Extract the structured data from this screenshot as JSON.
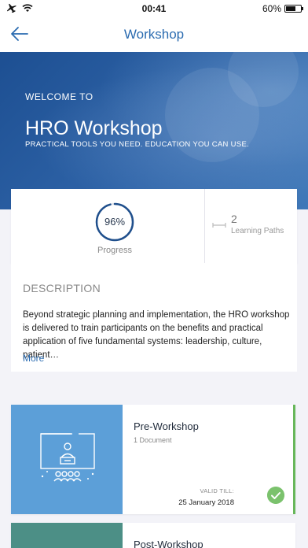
{
  "status_bar": {
    "time": "00:41",
    "battery": "60%"
  },
  "nav": {
    "title": "Workshop"
  },
  "hero": {
    "welcome": "WELCOME TO",
    "title": "HRO Workshop",
    "subtitle": "PRACTICAL TOOLS YOU NEED. EDUCATION YOU CAN USE."
  },
  "stats": {
    "progress_percent": 96,
    "progress_text": "96%",
    "progress_label": "Progress",
    "learning_paths_count": "2",
    "learning_paths_label": "Learning Paths"
  },
  "description": {
    "title": "DESCRIPTION",
    "text": "Beyond strategic planning and implementation, the HRO workshop is delivered to train participants on the benefits and practical application of five fundamental systems: leadership, culture, patient…",
    "more_label": "More"
  },
  "cards": [
    {
      "title": "Pre-Workshop",
      "meta": "1 Document",
      "valid_label": "VALID TILL:",
      "valid_date": "25 January 2018",
      "completed": true,
      "icon": "presentation-icon"
    },
    {
      "title": "Post-Workshop"
    }
  ],
  "colors": {
    "accent_blue": "#2a6bb0",
    "thumb_blue": "#5c9fd8",
    "thumb_teal": "#4c8f86",
    "complete_green": "#67b75a"
  }
}
